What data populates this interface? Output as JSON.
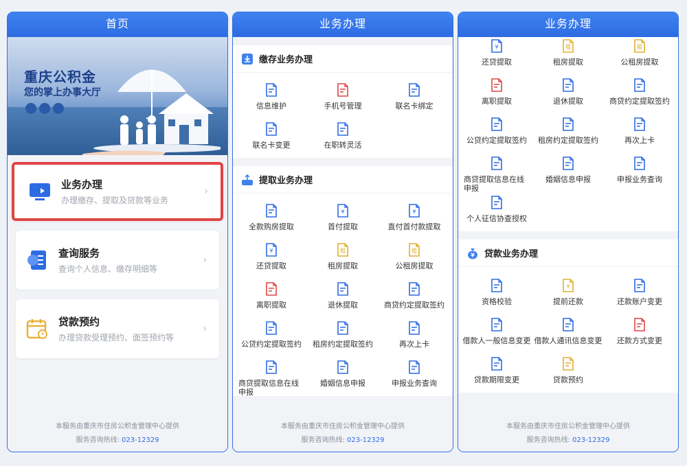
{
  "colors": {
    "accent": "#2d6be2",
    "highlight": "#e04444"
  },
  "footer": {
    "provider": "本服务由重庆市住房公积金管理中心提供",
    "hotline_label": "服务咨询热线:",
    "hotline": "023-12329"
  },
  "home": {
    "title": "首页",
    "banner": {
      "brand": "重庆公积金",
      "slogan": "您的掌上办事大厅"
    },
    "services": [
      {
        "title": "业务办理",
        "desc": "办理缴存、提取及贷款等业务",
        "icon": "monitor-icon"
      },
      {
        "title": "查询服务",
        "desc": "查询个人信息、缴存明细等",
        "icon": "document-search-icon"
      },
      {
        "title": "贷款预约",
        "desc": "办理贷款受理预约、面签预约等",
        "icon": "calendar-icon"
      }
    ]
  },
  "business": {
    "title": "业务办理",
    "deposit": {
      "title": "缴存业务办理",
      "items": [
        "信息维护",
        "手机号管理",
        "联名卡绑定",
        "联名卡变更",
        "在职转灵活"
      ]
    },
    "withdraw": {
      "title": "提取业务办理",
      "items": [
        "全款购房提取",
        "首付提取",
        "直付首付款提取",
        "还贷提取",
        "租房提取",
        "公租房提取",
        "离职提取",
        "退休提取",
        "商贷约定提取签约",
        "公贷约定提取签约",
        "租房约定提取签约",
        "再次上卡",
        "商贷提取信息在线申报",
        "婚姻信息申报",
        "申报业务查询"
      ]
    }
  },
  "business2": {
    "title": "业务办理",
    "withdraw_items": [
      "还贷提取",
      "租房提取",
      "公租房提取",
      "离职提取",
      "退休提取",
      "商贷约定提取签约",
      "公贷约定提取签约",
      "租房约定提取签约",
      "再次上卡",
      "商贷提取信息在线申报",
      "婚姻信息申报",
      "申报业务查询",
      "个人征信协查授权"
    ],
    "loan": {
      "title": "贷款业务办理",
      "items": [
        "资格校验",
        "提前还款",
        "还款账户变更",
        "借款人一般信息变更",
        "借款人通讯信息变更",
        "还款方式变更",
        "贷款期限变更",
        "贷款预约"
      ]
    }
  }
}
